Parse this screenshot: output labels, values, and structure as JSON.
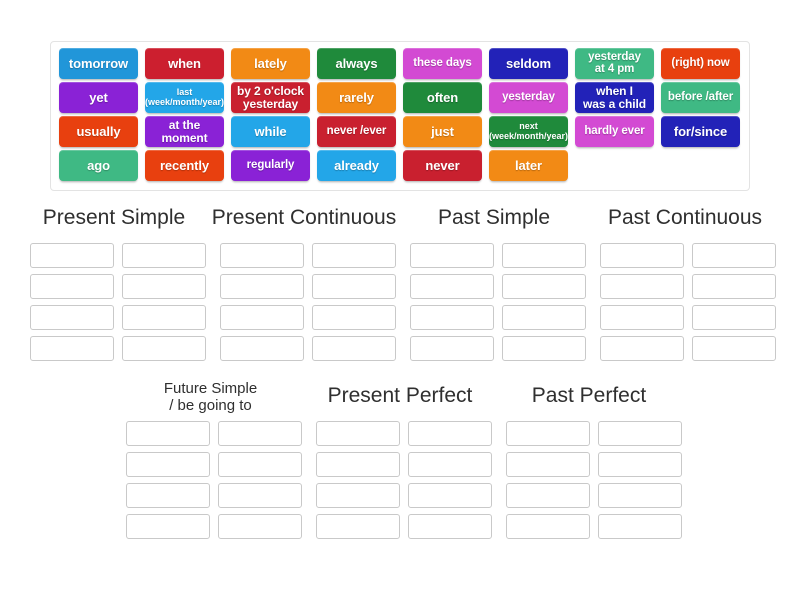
{
  "word_bank": {
    "name": "word-tiles-tray",
    "rows": [
      [
        {
          "label": "tomorrow",
          "color": "#2196d9",
          "size": "lg"
        },
        {
          "label": "when",
          "color": "#cc1f2f",
          "size": "lg"
        },
        {
          "label": "lately",
          "color": "#f28a15",
          "size": "lg"
        },
        {
          "label": "always",
          "color": "#1f8a3b",
          "size": "lg"
        },
        {
          "label": "these days",
          "color": "#d34ad3",
          "size": "md"
        },
        {
          "label": "seldom",
          "color": "#2222b8",
          "size": "lg"
        },
        {
          "label": "yesterday\nat 4 pm",
          "color": "#3fb984",
          "size": "md"
        },
        {
          "label": "(right) now",
          "color": "#e8400f",
          "size": "md"
        }
      ],
      [
        {
          "label": "yet",
          "color": "#8a22d6",
          "size": "lg"
        },
        {
          "label": "last\n(week/month/year)",
          "color": "#23a6e8",
          "size": "sm"
        },
        {
          "label": "by 2 o'clock\nyesterday",
          "color": "#c9202f",
          "size": "xs"
        },
        {
          "label": "rarely",
          "color": "#f28a15",
          "size": "lg"
        },
        {
          "label": "often",
          "color": "#1f8a3b",
          "size": "lg"
        },
        {
          "label": "yesterday",
          "color": "#d34ad3",
          "size": "md"
        },
        {
          "label": "when I\nwas a child",
          "color": "#2222b8",
          "size": "xs"
        },
        {
          "label": "before /after",
          "color": "#3fb984",
          "size": "md"
        }
      ],
      [
        {
          "label": "usually",
          "color": "#e8400f",
          "size": "lg"
        },
        {
          "label": "at the\nmoment",
          "color": "#8a22d6",
          "size": "xs"
        },
        {
          "label": "while",
          "color": "#23a6e8",
          "size": "lg"
        },
        {
          "label": "never /ever",
          "color": "#c9202f",
          "size": "md"
        },
        {
          "label": "just",
          "color": "#f28a15",
          "size": "lg"
        },
        {
          "label": "next\n(week/month/year)",
          "color": "#1f8a3b",
          "size": "sm"
        },
        {
          "label": "hardly ever",
          "color": "#d34ad3",
          "size": "md"
        },
        {
          "label": "for/since",
          "color": "#2222b8",
          "size": "lg"
        }
      ],
      [
        {
          "label": "ago",
          "color": "#3fb984",
          "size": "lg"
        },
        {
          "label": "recently",
          "color": "#e8400f",
          "size": "lg"
        },
        {
          "label": "regularly",
          "color": "#8a22d6",
          "size": "md"
        },
        {
          "label": "already",
          "color": "#23a6e8",
          "size": "lg"
        },
        {
          "label": "never",
          "color": "#c9202f",
          "size": "lg"
        },
        {
          "label": "later",
          "color": "#f28a15",
          "size": "lg"
        },
        {
          "label": "",
          "color": "transparent",
          "size": "lg",
          "empty": true
        },
        {
          "label": "",
          "color": "transparent",
          "size": "lg",
          "empty": true
        }
      ]
    ]
  },
  "categories_top": [
    {
      "title": "Present Simple",
      "slots": 8
    },
    {
      "title": "Present Continuous",
      "slots": 8
    },
    {
      "title": "Past Simple",
      "slots": 8
    },
    {
      "title": "Past Continuous",
      "slots": 8
    }
  ],
  "categories_bottom": [
    {
      "title": "Future Simple\n/ be going to",
      "slots": 8
    },
    {
      "title": "Present Perfect",
      "slots": 8
    },
    {
      "title": "Past Perfect",
      "slots": 8
    }
  ]
}
